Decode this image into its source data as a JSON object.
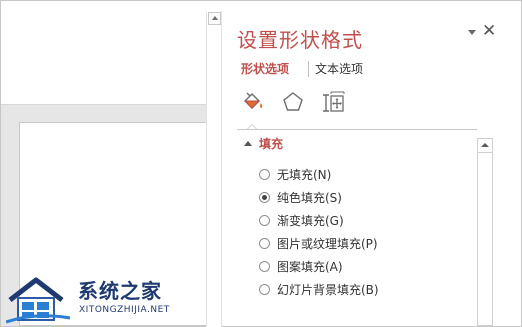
{
  "pane": {
    "title": "设置形状格式",
    "tabs": {
      "shape_options": "形状选项",
      "text_options": "文本选项"
    },
    "icons": [
      "fill-line-icon",
      "effects-pentagon-icon",
      "size-properties-icon"
    ],
    "section": {
      "title": "填充",
      "options": [
        {
          "label": "无填充(N)",
          "checked": false
        },
        {
          "label": "纯色填充(S)",
          "checked": true
        },
        {
          "label": "渐变填充(G)",
          "checked": false
        },
        {
          "label": "图片或纹理填充(P)",
          "checked": false
        },
        {
          "label": "图案填充(A)",
          "checked": false
        },
        {
          "label": "幻灯片背景填充(B)",
          "checked": false
        }
      ]
    }
  },
  "watermark": {
    "name": "系统之家",
    "url": "XITONGZHIJIA.NET"
  },
  "colors": {
    "accent": "#c0504d",
    "watermark": "#1e3a70"
  }
}
